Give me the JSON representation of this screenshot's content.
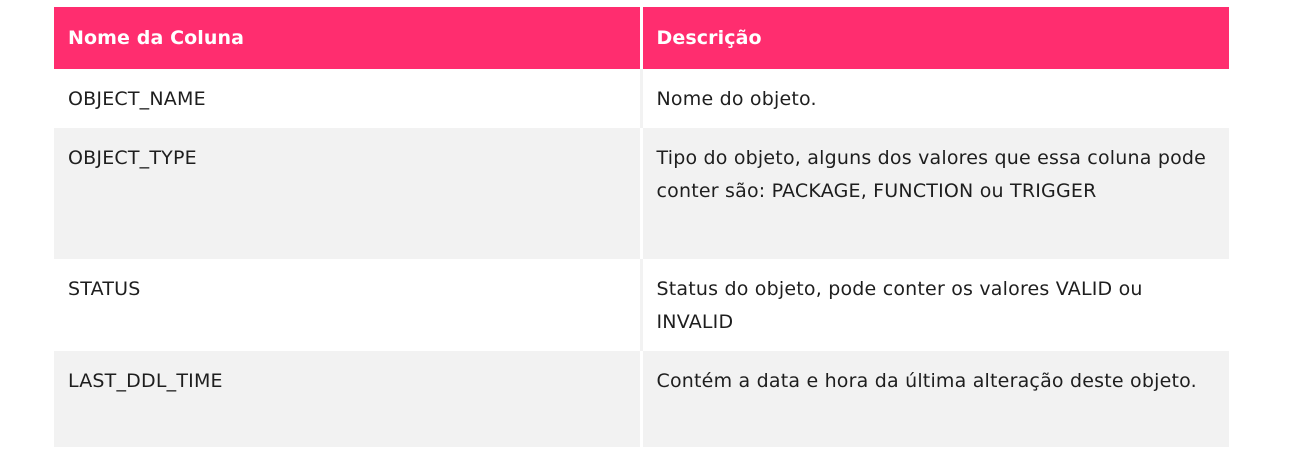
{
  "table": {
    "headers": [
      "Nome da Coluna",
      "Descrição"
    ],
    "rows": [
      {
        "name": "OBJECT_NAME",
        "description": "Nome do objeto."
      },
      {
        "name": "OBJECT_TYPE",
        "description": "Tipo do objeto, alguns dos valores que essa coluna pode conter são: PACKAGE, FUNCTION ou TRIGGER"
      },
      {
        "name": "STATUS",
        "description": "Status do objeto, pode conter os valores VALID ou INVALID"
      },
      {
        "name": "LAST_DDL_TIME",
        "description": "Contém a data e hora da última alteração deste objeto."
      }
    ]
  },
  "colors": {
    "header_bg": "#ff2d6f",
    "header_text": "#ffffff",
    "row_alt_bg": "#f2f2f2",
    "row_bg": "#ffffff",
    "text": "#1e1e1e"
  }
}
